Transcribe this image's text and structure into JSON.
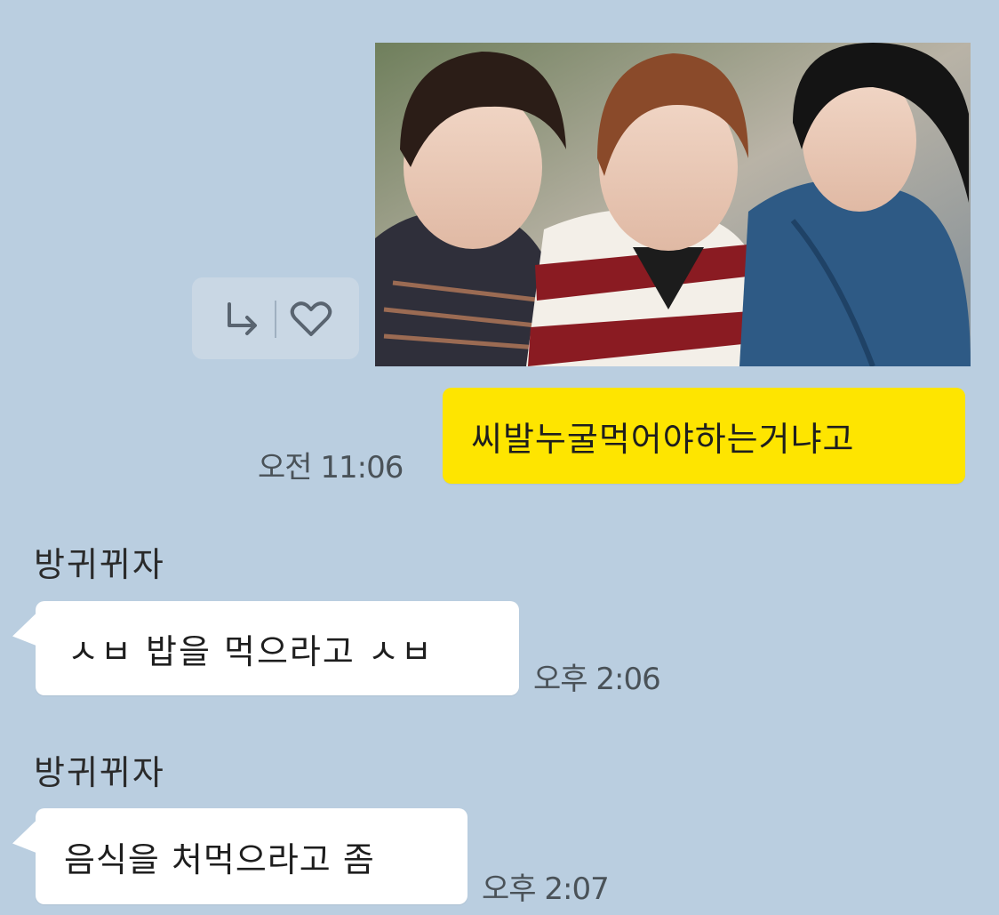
{
  "app": {
    "background_color": "#bacee0"
  },
  "photo_message": {
    "image": "photo of three young men posing closely together outdoors",
    "actions": {
      "share_icon": "share-forward-icon",
      "like_icon": "heart-outline-icon"
    }
  },
  "messages": [
    {
      "direction": "outgoing",
      "text": "씨발누굴먹어야하는거냐고",
      "time": "오전 11:06",
      "bubble_color": "#fee500"
    },
    {
      "direction": "incoming",
      "sender": "방귀뀌자",
      "text": "ㅅㅂ 밥을 먹으라고 ㅅㅂ",
      "time": "오후 2:06",
      "bubble_color": "#ffffff"
    },
    {
      "direction": "incoming",
      "sender": "방귀뀌자",
      "text": "음식을 처먹으라고 좀",
      "time": "오후 2:07",
      "bubble_color": "#ffffff"
    }
  ]
}
